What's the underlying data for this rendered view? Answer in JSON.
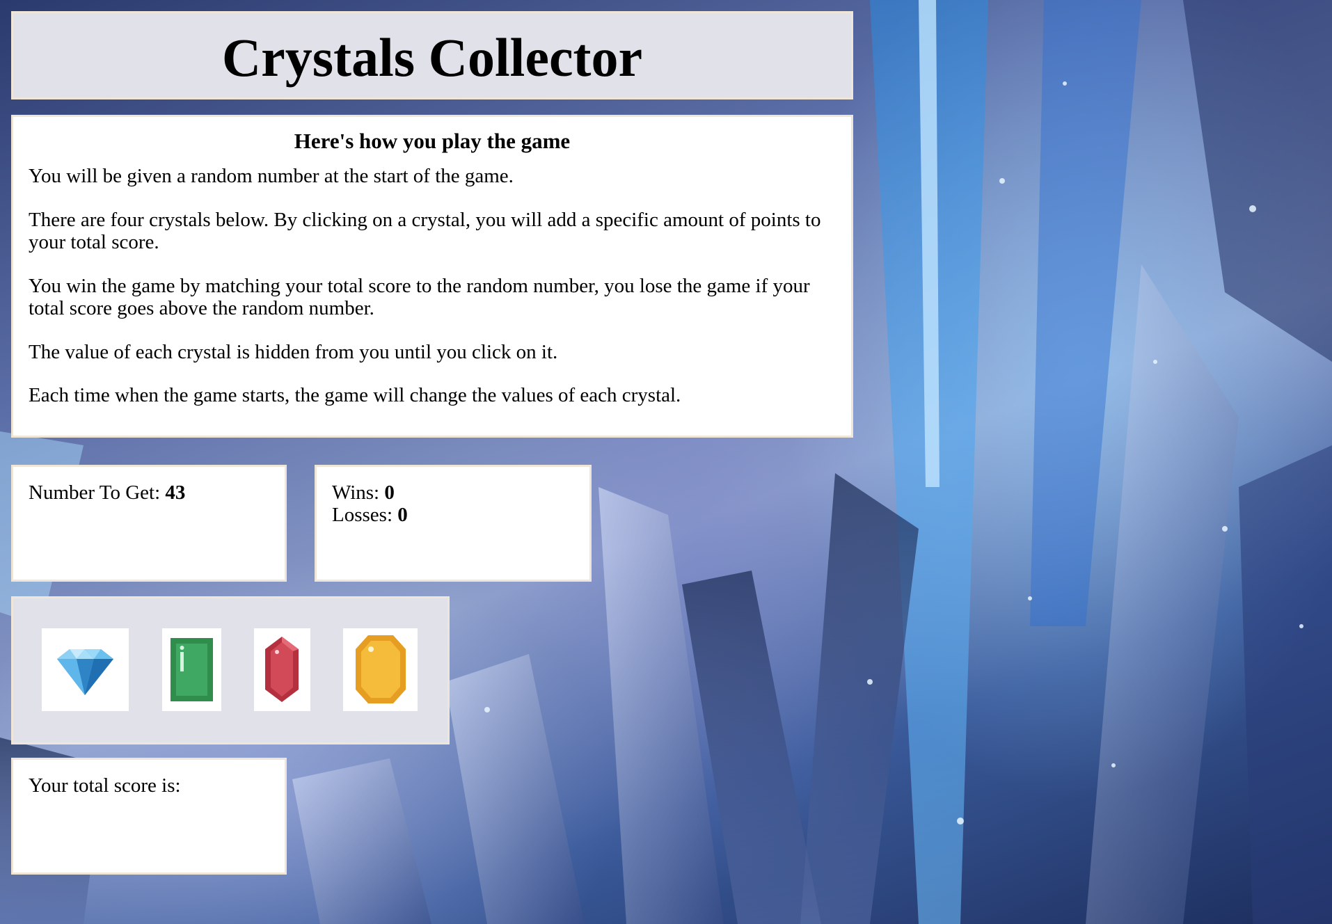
{
  "header": {
    "title": "Crystals Collector"
  },
  "instructions": {
    "heading": "Here's how you play the game",
    "paragraphs": [
      "You will be given a random number at the start of the game.",
      "There are four crystals below. By clicking on a crystal, you will add a specific amount of points to your total score.",
      "You win the game by matching your total score to the random number, you lose the game if your total score goes above the random number.",
      "The value of each crystal is hidden from you until you click on it.",
      "Each time when the game starts, the game will change the values of each crystal."
    ]
  },
  "target": {
    "label": "Number To Get: ",
    "value": "43"
  },
  "record": {
    "wins_label": "Wins: ",
    "wins_value": "0",
    "losses_label": "Losses: ",
    "losses_value": "0"
  },
  "crystals": [
    {
      "icon": "blue-diamond-icon",
      "color": "#4aa8e0"
    },
    {
      "icon": "green-emerald-icon",
      "color": "#3f9a5a"
    },
    {
      "icon": "red-ruby-icon",
      "color": "#c8424f"
    },
    {
      "icon": "yellow-topaz-icon",
      "color": "#f2b233"
    }
  ],
  "score": {
    "label": "Your total score is:",
    "value": ""
  }
}
